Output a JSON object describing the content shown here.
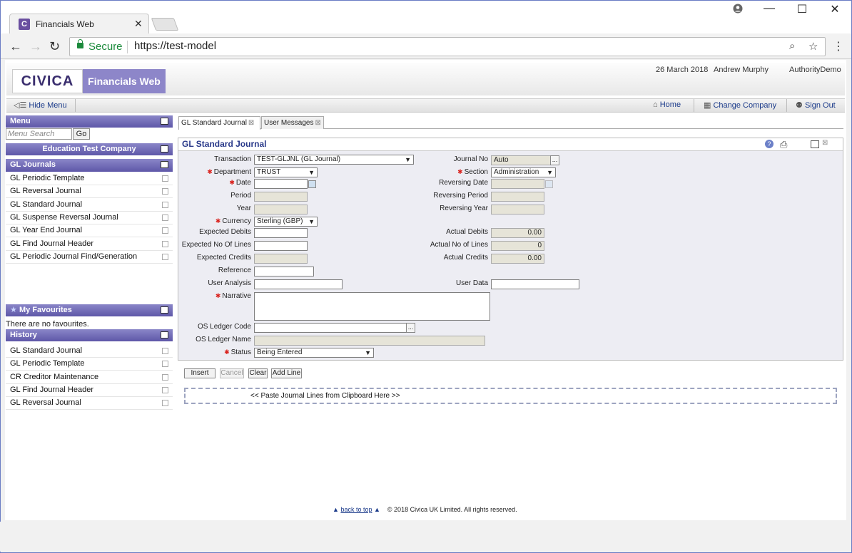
{
  "browser": {
    "tab_title": "Financials Web",
    "tab_icon": "C",
    "secure_label": "Secure",
    "url": "https://test-model"
  },
  "header": {
    "logo": "CIVICA",
    "app_name": "Financials Web",
    "date": "26 March 2018",
    "user": "Andrew Murphy",
    "authority": "AuthorityDemo"
  },
  "toolbar": {
    "hide_menu": "Hide Menu",
    "home": "Home",
    "change_company": "Change Company",
    "sign_out": "Sign Out"
  },
  "sidebar": {
    "menu_title": "Menu",
    "search_placeholder": "Menu Search",
    "go_label": "Go",
    "company": "Education Test Company",
    "section_title": "GL Journals",
    "items": [
      {
        "label": "GL Periodic Template"
      },
      {
        "label": "GL Reversal Journal"
      },
      {
        "label": "GL Standard Journal"
      },
      {
        "label": "GL Suspense Reversal Journal"
      },
      {
        "label": "GL Year End Journal"
      },
      {
        "label": "GL Find Journal Header"
      },
      {
        "label": "GL Periodic Journal Find/Generation"
      }
    ],
    "favourites_title": "My Favourites",
    "favourites_empty": "There are no favourites.",
    "history_title": "History",
    "history": [
      {
        "label": "GL Standard Journal"
      },
      {
        "label": "GL Periodic Template"
      },
      {
        "label": "CR Creditor Maintenance"
      },
      {
        "label": "GL Find Journal Header"
      },
      {
        "label": "GL Reversal Journal"
      }
    ]
  },
  "tabs": [
    {
      "label": "GL Standard Journal"
    },
    {
      "label": "User Messages"
    }
  ],
  "form": {
    "title": "GL Standard Journal",
    "transaction_label": "Transaction",
    "transaction_value": "TEST-GLJNL (GL Journal)",
    "department_label": "Department",
    "department_value": "TRUST",
    "date_label": "Date",
    "date_value": "",
    "period_label": "Period",
    "year_label": "Year",
    "currency_label": "Currency",
    "currency_value": "Sterling (GBP)",
    "expected_debits_label": "Expected Debits",
    "expected_lines_label": "Expected No Of Lines",
    "expected_credits_label": "Expected Credits",
    "reference_label": "Reference",
    "user_analysis_label": "User Analysis",
    "narrative_label": "Narrative",
    "os_ledger_code_label": "OS Ledger Code",
    "os_ledger_name_label": "OS Ledger Name",
    "status_label": "Status",
    "status_value": "Being Entered",
    "journal_no_label": "Journal No",
    "journal_no_value": "Auto",
    "section_label": "Section",
    "section_value": "Administration",
    "reversing_date_label": "Reversing Date",
    "reversing_period_label": "Reversing Period",
    "reversing_year_label": "Reversing Year",
    "actual_debits_label": "Actual Debits",
    "actual_debits_value": "0.00",
    "actual_lines_label": "Actual No of Lines",
    "actual_lines_value": "0",
    "actual_credits_label": "Actual Credits",
    "actual_credits_value": "0.00",
    "user_data_label": "User Data"
  },
  "buttons": {
    "insert": "Insert",
    "cancel": "Cancel",
    "clear": "Clear",
    "add_line": "Add Line"
  },
  "paste_area": "<< Paste Journal Lines from Clipboard Here >>",
  "footer": {
    "back_to_top": "back to top",
    "copyright": "© 2018 Civica UK Limited. All rights reserved."
  },
  "colors": {
    "accent": "#6a63b5",
    "required": "#d9201b",
    "secure": "#1b8a3b"
  }
}
